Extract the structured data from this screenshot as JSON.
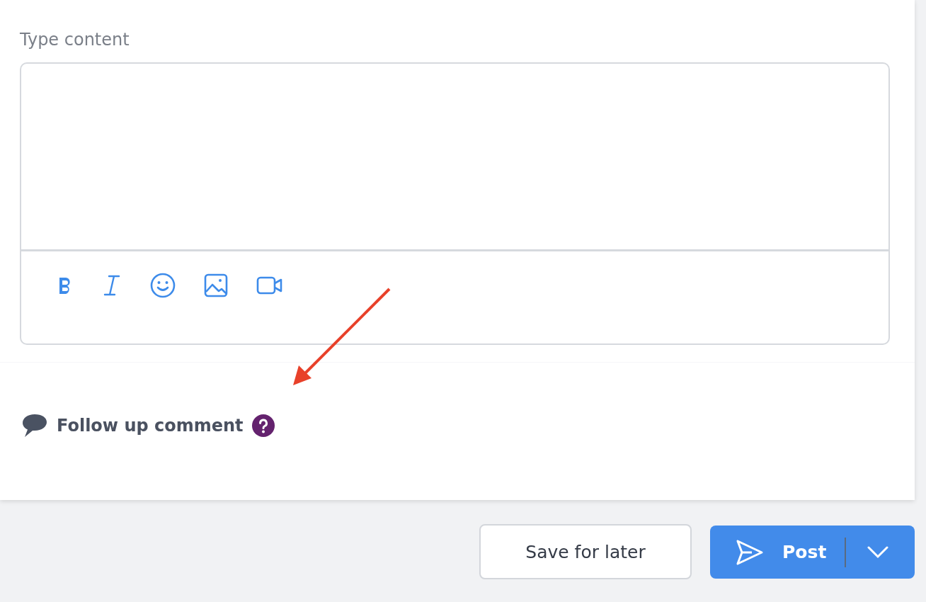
{
  "editor": {
    "label": "Type content",
    "tools": [
      {
        "kind": "bold"
      },
      {
        "kind": "italic"
      },
      {
        "kind": "emoji"
      },
      {
        "kind": "image"
      },
      {
        "kind": "video"
      }
    ]
  },
  "follow_up": {
    "title": "Follow up comment"
  },
  "buttons": [
    {
      "kind": "secondary",
      "label": "Save for later"
    },
    {
      "kind": "primary",
      "label": "Post"
    }
  ]
}
